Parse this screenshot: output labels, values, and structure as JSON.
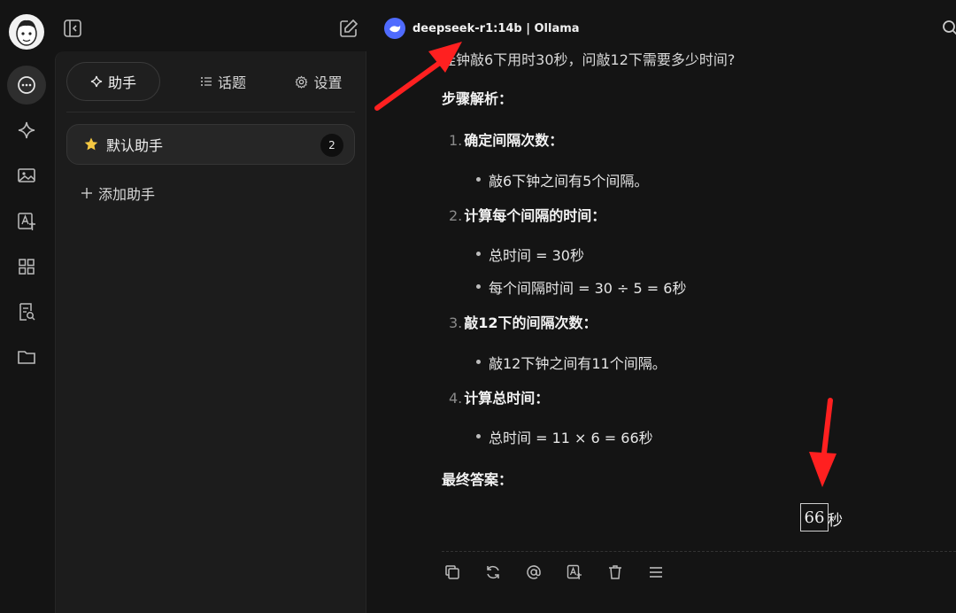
{
  "header": {
    "model_name": "deepseek-r1:14b | Ollama"
  },
  "panel": {
    "tabs": [
      {
        "label": "助手",
        "icon": "sparkle-icon"
      },
      {
        "label": "话题",
        "icon": "list-icon"
      },
      {
        "label": "设置",
        "icon": "gear-icon"
      }
    ],
    "assistant_item": {
      "label": "默认助手",
      "count": "2",
      "icon": "star-icon"
    },
    "add_label": "添加助手"
  },
  "chat": {
    "question_partial": "挂钟敲6下用时30秒，问敲12下需要多少时间?",
    "steps_heading": "步骤解析：",
    "steps": [
      {
        "num": "1.",
        "title": "确定间隔次数：",
        "bullets": [
          "敲6下钟之间有5个间隔。"
        ]
      },
      {
        "num": "2.",
        "title": "计算每个间隔的时间：",
        "bullets": [
          "总时间 = 30秒",
          "每个间隔时间 = 30 ÷ 5 = 6秒"
        ]
      },
      {
        "num": "3.",
        "title": "敲12下的间隔次数：",
        "bullets": [
          "敲12下钟之间有11个间隔。"
        ]
      },
      {
        "num": "4.",
        "title": "计算总时间：",
        "bullets": [
          "总时间 = 11 × 6 = 66秒"
        ]
      }
    ],
    "final_heading": "最终答案：",
    "final_value": "66",
    "final_unit": "秒"
  },
  "colors": {
    "background": "#141414",
    "panel": "#1c1c1c",
    "accent_model": "#4f6bff",
    "annotation_arrow": "#ff2020",
    "star": "#f5c842"
  }
}
